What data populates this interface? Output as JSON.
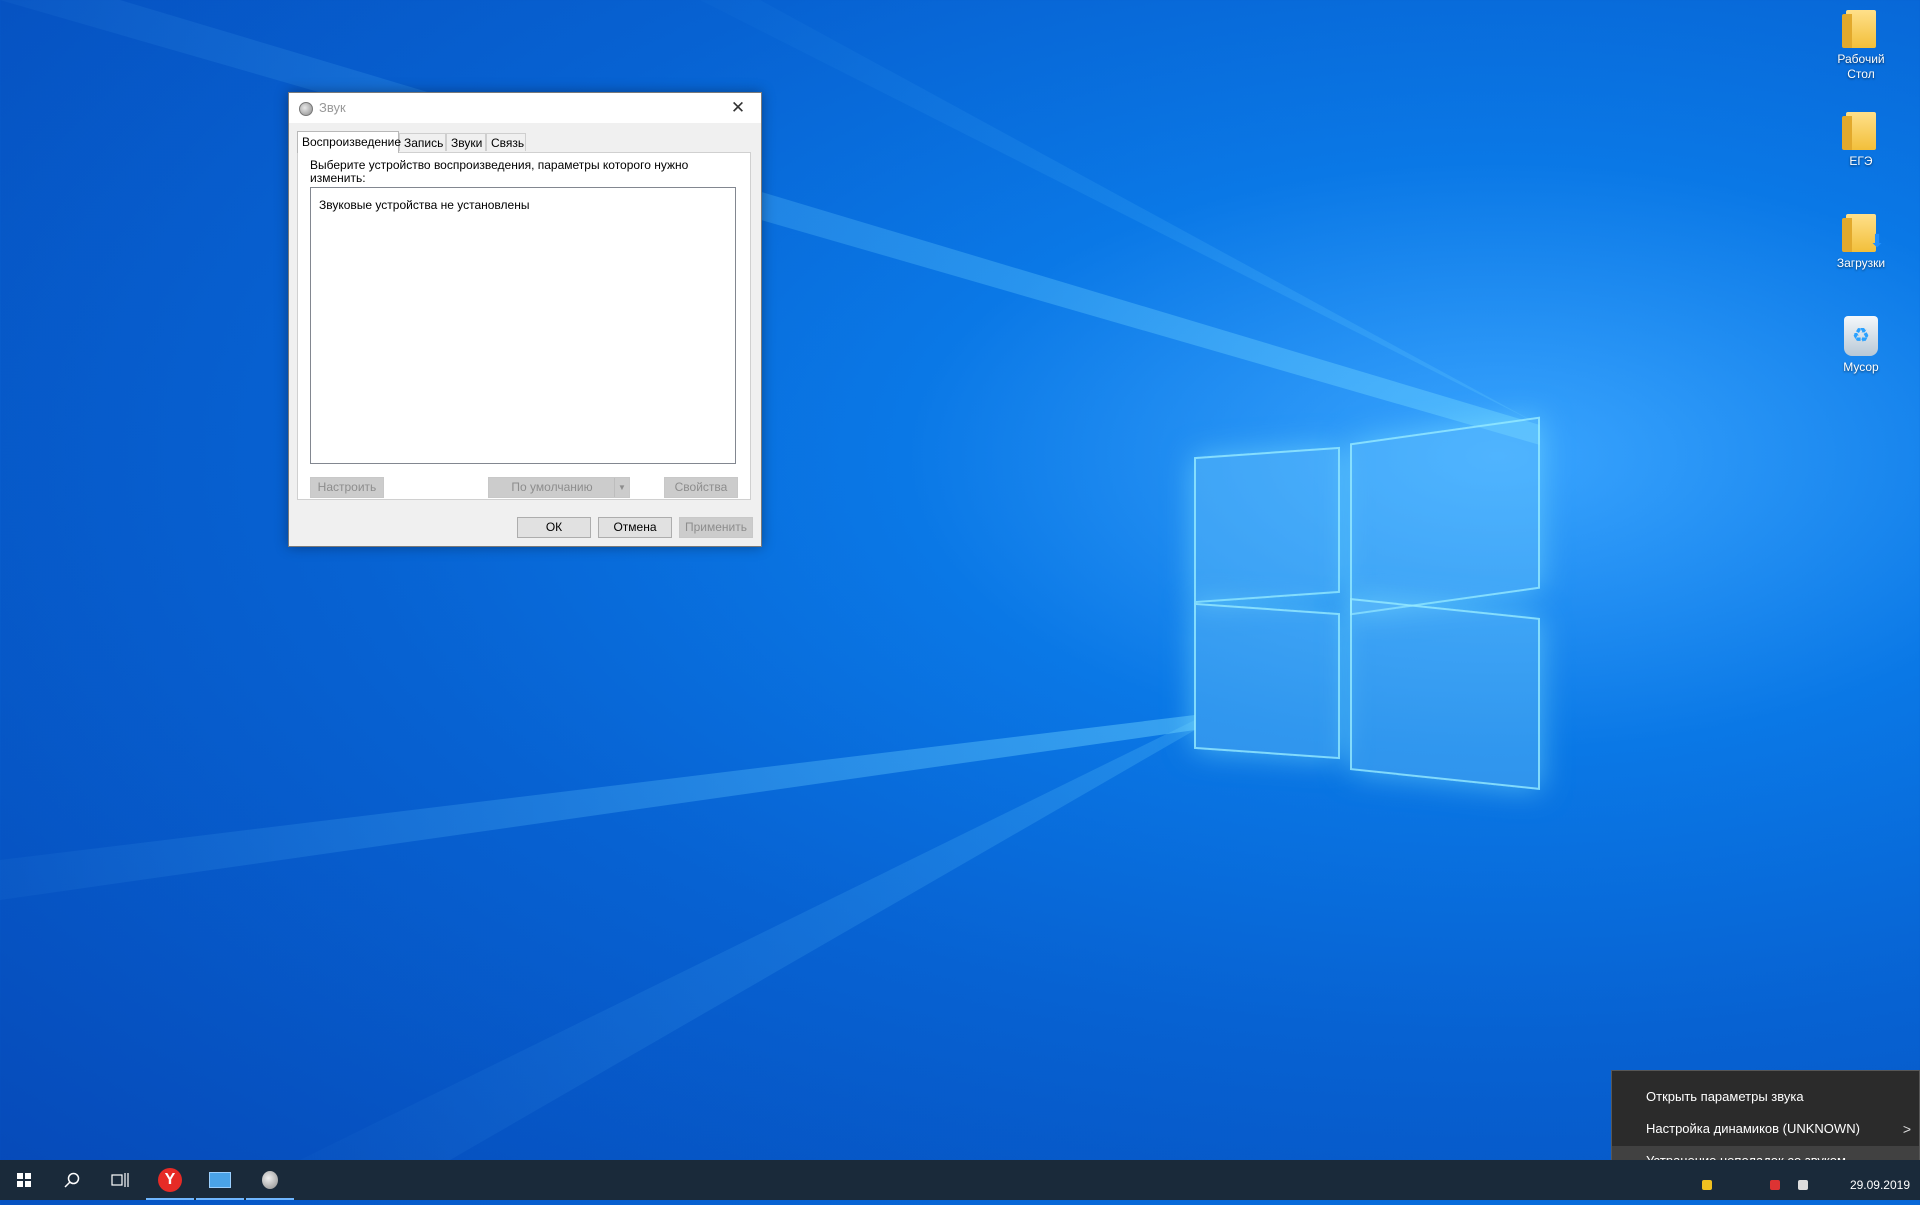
{
  "desktop": {
    "icons": [
      {
        "label": "Рабочий\nСтол",
        "line1": "Рабочий",
        "line2": "Стол",
        "icon": "folder-icon"
      },
      {
        "label": "ЕГЭ",
        "icon": "folder-icon"
      },
      {
        "label": "Загрузки",
        "icon": "downloads-folder-icon"
      },
      {
        "label": "Мусор",
        "icon": "recycle-bin-icon"
      }
    ]
  },
  "dialog": {
    "title": "Звук",
    "tabs": [
      {
        "label": "Воспроизведение",
        "active": true
      },
      {
        "label": "Запись"
      },
      {
        "label": "Звуки"
      },
      {
        "label": "Связь"
      }
    ],
    "instruction": "Выберите устройство воспроизведения, параметры которого нужно изменить:",
    "empty_message": "Звуковые устройства не установлены",
    "buttons": {
      "configure": "Настроить",
      "set_default": "По умолчанию",
      "properties": "Свойства",
      "ok": "ОК",
      "cancel": "Отмена",
      "apply": "Применить"
    }
  },
  "context_menu": {
    "items": [
      {
        "label": "Открыть параметры звука"
      },
      {
        "label": "Настройка динамиков (UNKNOWN)",
        "submenu": true
      },
      {
        "label": "Устранение неполадок со звуком",
        "hover": true
      }
    ]
  },
  "taskbar": {
    "date": "29.09.2019",
    "apps": [
      {
        "name": "search-icon"
      },
      {
        "name": "task-view-icon"
      },
      {
        "name": "yandex-browser-icon",
        "glyph": "Y",
        "running": true
      },
      {
        "name": "control-panel-icon",
        "running": true
      },
      {
        "name": "sound-settings-icon",
        "running": true
      }
    ]
  },
  "colors": {
    "accent": "#0a78e6",
    "menu_bg": "#2b2b2b",
    "taskbar_bg": "#1a2a3a"
  }
}
